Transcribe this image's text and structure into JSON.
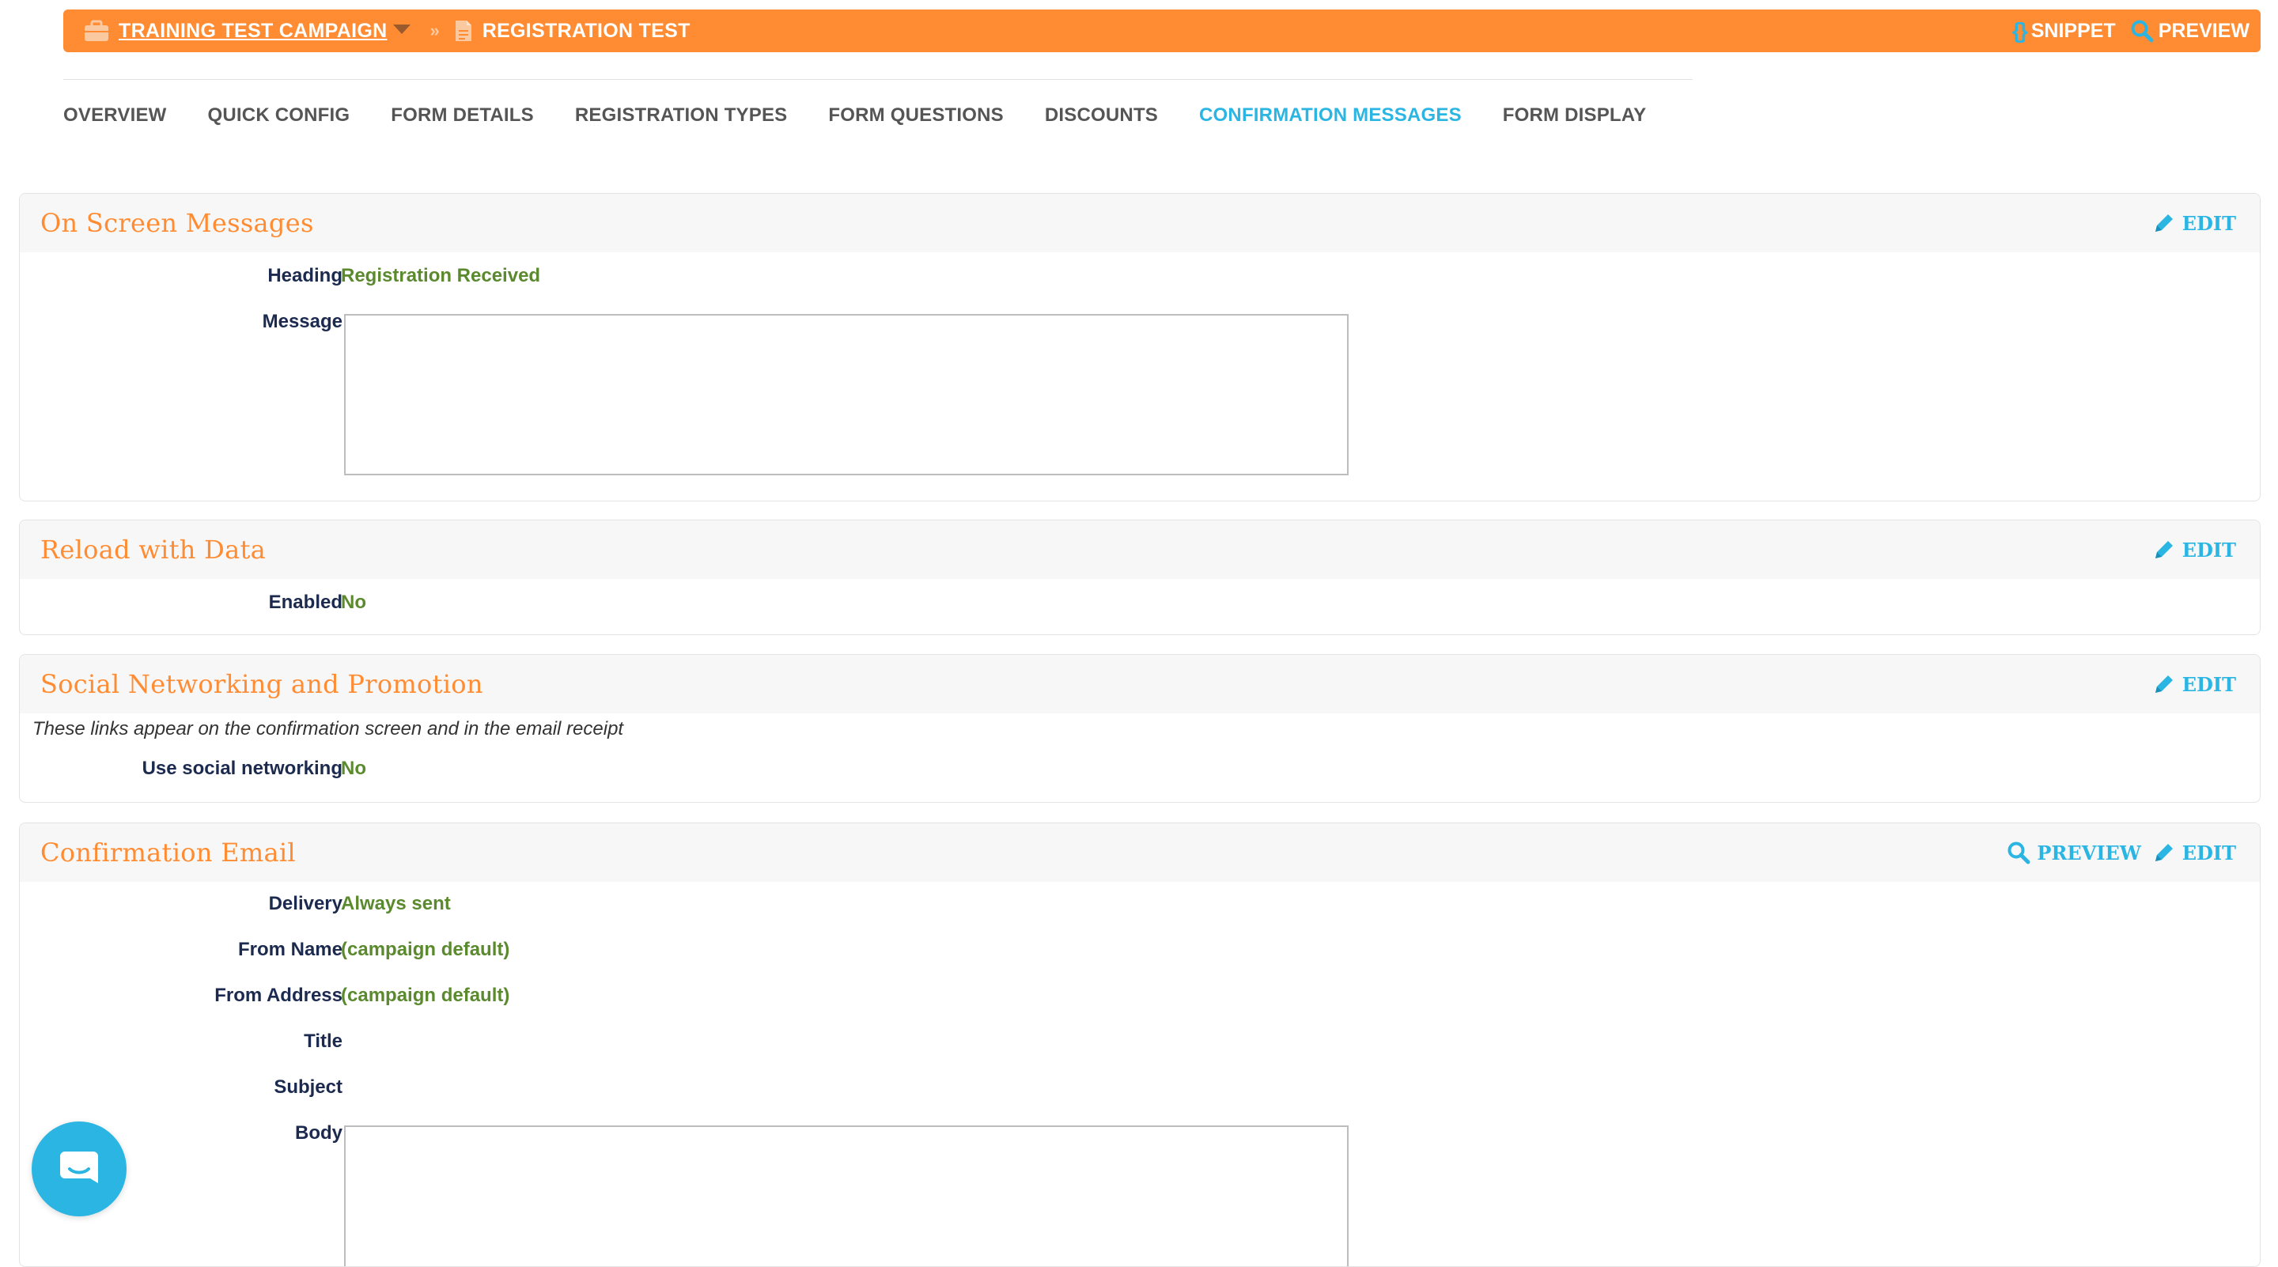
{
  "breadcrumb": {
    "campaign": "TRAINING TEST CAMPAIGN",
    "separator": "»",
    "form": "REGISTRATION TEST"
  },
  "topbar_actions": {
    "snippet": "SNIPPET",
    "preview": "PREVIEW"
  },
  "tabs": [
    {
      "label": "OVERVIEW"
    },
    {
      "label": "QUICK CONFIG"
    },
    {
      "label": "FORM DETAILS"
    },
    {
      "label": "REGISTRATION TYPES"
    },
    {
      "label": "FORM QUESTIONS"
    },
    {
      "label": "DISCOUNTS"
    },
    {
      "label": "CONFIRMATION MESSAGES",
      "active": true
    },
    {
      "label": "FORM DISPLAY"
    }
  ],
  "on_screen": {
    "title": "On Screen Messages",
    "edit": "EDIT",
    "heading_label": "Heading",
    "heading_value": "Registration Received",
    "message_label": "Message",
    "message_value": ""
  },
  "reload": {
    "title": "Reload with Data",
    "edit": "EDIT",
    "enabled_label": "Enabled",
    "enabled_value": "No"
  },
  "social": {
    "title": "Social Networking and Promotion",
    "edit": "EDIT",
    "note": "These links appear on the confirmation screen and in the email receipt",
    "use_label": "Use social networking",
    "use_value": "No"
  },
  "email": {
    "title": "Confirmation Email",
    "preview": "PREVIEW",
    "edit": "EDIT",
    "delivery_label": "Delivery",
    "delivery_value": "Always sent",
    "from_name_label": "From Name",
    "from_name_value": "(campaign default)",
    "from_address_label": "From Address",
    "from_address_value": "(campaign default)",
    "title_label": "Title",
    "title_value": "",
    "subject_label": "Subject",
    "subject_value": "",
    "body_label": "Body",
    "body_value": ""
  },
  "colors": {
    "brand_orange": "#ff8c33",
    "accent_blue": "#2bb5e3",
    "label_navy": "#1b2a4e",
    "value_green": "#5b8a2e"
  }
}
